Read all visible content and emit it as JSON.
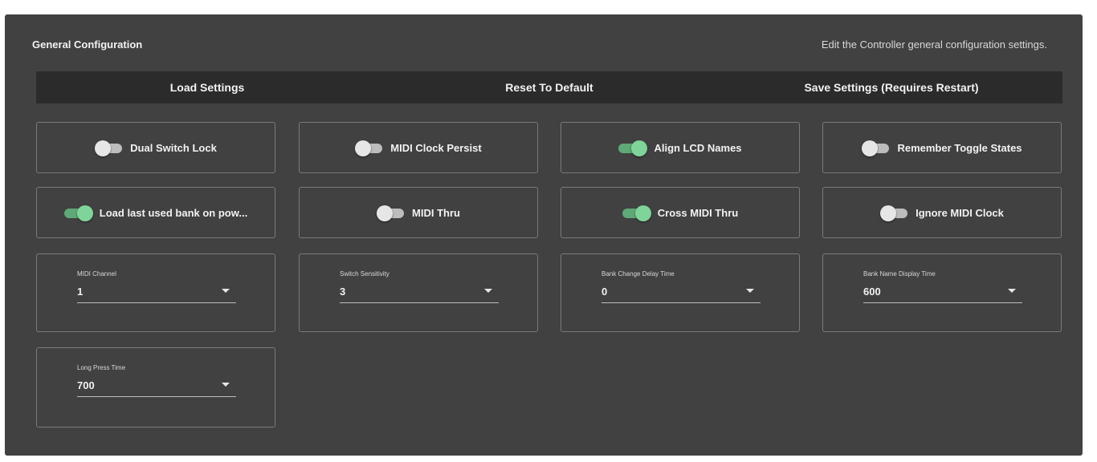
{
  "header": {
    "title": "General Configuration",
    "description": "Edit the Controller general configuration settings."
  },
  "actions": {
    "load": "Load Settings",
    "reset": "Reset To Default",
    "save": "Save Settings (Requires Restart)"
  },
  "toggles": [
    {
      "label": "Dual Switch Lock",
      "on": false
    },
    {
      "label": "MIDI Clock Persist",
      "on": false
    },
    {
      "label": "Align LCD Names",
      "on": true
    },
    {
      "label": "Remember Toggle States",
      "on": false
    },
    {
      "label": "Load last used bank on pow...",
      "on": true
    },
    {
      "label": "MIDI Thru",
      "on": false
    },
    {
      "label": "Cross MIDI Thru",
      "on": true
    },
    {
      "label": "Ignore MIDI Clock",
      "on": false
    }
  ],
  "selects": [
    {
      "label": "MIDI Channel",
      "value": "1"
    },
    {
      "label": "Switch Sensitivity",
      "value": "3"
    },
    {
      "label": "Bank Change Delay Time",
      "value": "0"
    },
    {
      "label": "Bank Name Display Time",
      "value": "600"
    },
    {
      "label": "Long Press Time",
      "value": "700"
    }
  ],
  "colors": {
    "panel": "#414141",
    "actionbar": "#2b2b2b",
    "toggle_on": "#7fd49a",
    "toggle_off": "#e6e6e6"
  }
}
